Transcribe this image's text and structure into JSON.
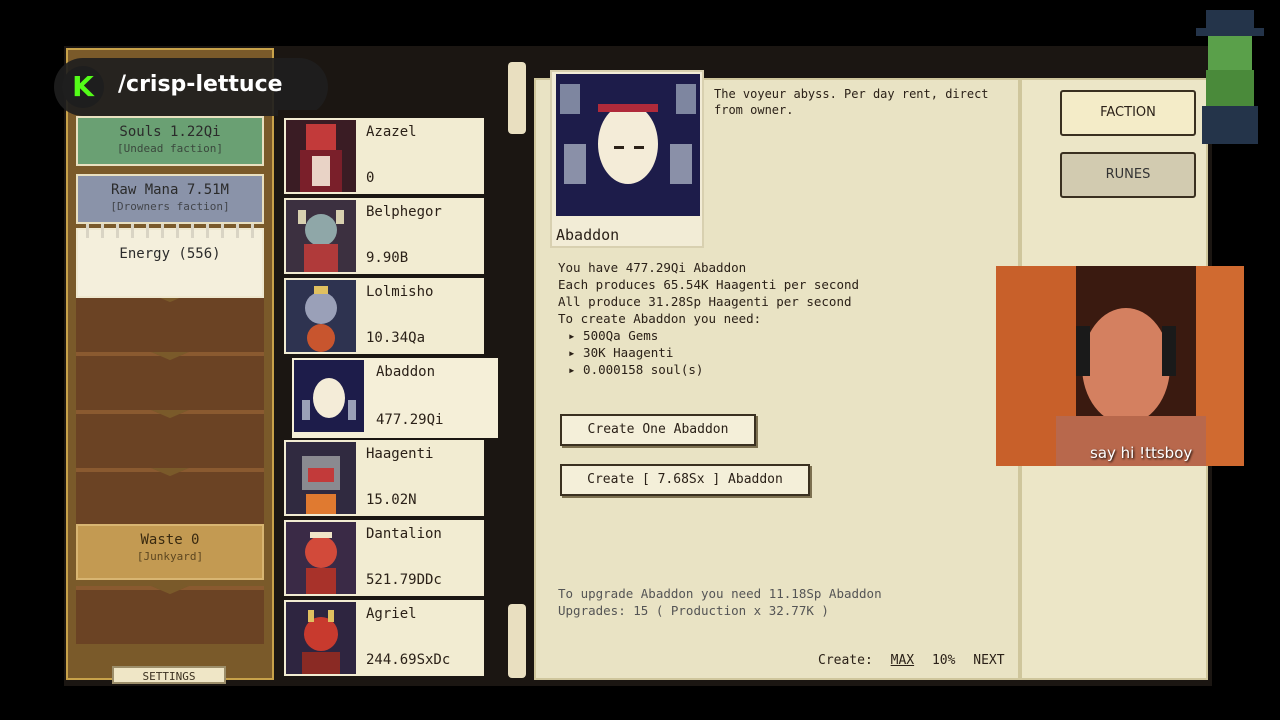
{
  "overlay": {
    "channel": "/crisp-lettuce",
    "logo_letter": "K"
  },
  "resources": {
    "souls": {
      "label": "Souls 1.22Qi",
      "sub": "[Undead faction]"
    },
    "mana": {
      "label": "Raw Mana 7.51M",
      "sub": "[Drowners faction]"
    },
    "energy": {
      "label": "Energy (556)"
    },
    "waste": {
      "label": "Waste 0",
      "sub": "[Junkyard]"
    },
    "settings": "SETTINGS"
  },
  "demons": [
    {
      "name": "Azazel",
      "value": "0"
    },
    {
      "name": "Belphegor",
      "value": "9.90B"
    },
    {
      "name": "Lolmisho",
      "value": "10.34Qa"
    },
    {
      "name": "Abaddon",
      "value": "477.29Qi"
    },
    {
      "name": "Haagenti",
      "value": "15.02N"
    },
    {
      "name": "Dantalion",
      "value": "521.79DDc"
    },
    {
      "name": "Agriel",
      "value": "244.69SxDc"
    }
  ],
  "detail": {
    "name": "Abaddon",
    "description": "The voyeur abyss. Per day rent, direct from owner.",
    "stats": [
      "You have 477.29Qi Abaddon",
      "Each produces 65.54K Haagenti per second",
      "All produce 31.28Sp Haagenti per second",
      "To create Abaddon you need:"
    ],
    "requirements": [
      "▸ 500Qa Gems",
      "▸ 30K Haagenti",
      "▸ 0.000158 soul(s)"
    ],
    "create_one": "Create One Abaddon",
    "create_max": "Create [ 7.68Sx ] Abaddon",
    "upgrade_need": "To upgrade Abaddon you need 11.18Sp Abaddon",
    "upgrades": "Upgrades: 15  ( Production x 32.77K )",
    "create_label": "Create:",
    "create_opts": [
      "MAX",
      "10%",
      "NEXT"
    ]
  },
  "right": {
    "faction": "FACTION",
    "runes": "RUNES"
  },
  "webcam": {
    "caption": "say hi !ttsboy"
  },
  "colors": {
    "kick_green": "#53fc18",
    "souls_bg": "#6aa073",
    "mana_bg": "#8a93a9",
    "panel_bg": "#e9e3c4"
  }
}
